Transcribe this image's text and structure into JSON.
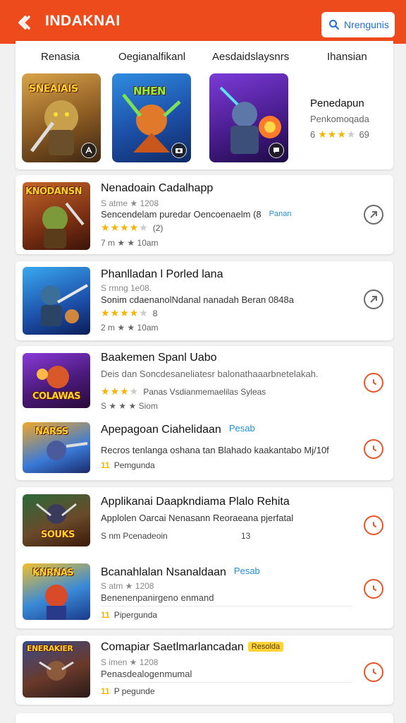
{
  "header": {
    "title": "INDAKNAI",
    "search_label": "Nrengunis",
    "bg_color": "#ee4b1c"
  },
  "featured": {
    "tabs": [
      "Renasia",
      "Oegianalfikanl",
      "Aesdaidslaysnrs",
      "Ihansian"
    ],
    "tiles": [
      {
        "label": "SNEAIAIS",
        "icon": "ninja-icon"
      },
      {
        "label": "NHEN",
        "icon": "camera-icon"
      },
      {
        "label": "",
        "icon": "chat-icon"
      }
    ],
    "info": {
      "title": "Penedapun",
      "subtitle": "Penkomoqada",
      "rating_value": "6",
      "stars": 3,
      "count": "69"
    }
  },
  "list1": {
    "item": {
      "title": "Nenadoain Cadalhapp",
      "line1": "S atme ★ 1208",
      "desc": "Sencendelam puredar Oencoenaelm (8",
      "desc_tag": "Panan",
      "stars": 4,
      "rating_extra": "(2)",
      "line3": "7 m ★ ★ 10am",
      "thumb_text": "KNODANSN"
    }
  },
  "list2": {
    "item": {
      "title": "Phanlladan l Porled lana",
      "line1": "S rmng 1e08.",
      "desc": "Sonim cdaenanolNdanal nanadah Beran 0848a",
      "stars": 4,
      "rating_extra": "8",
      "line3": "2 m ★ ★ 10am"
    }
  },
  "list3": {
    "items": [
      {
        "title": "Baakemen Spanl Uabo",
        "desc": "Deis dan Soncdesaneliatesr balonathaaarbnetelakah.",
        "stars": 3,
        "rating_text": "Panas Vsdianmemaelilas Syleas",
        "line3": "S ★ ★ ★ Siom",
        "thumb_text": "COLAWAS"
      },
      {
        "title": "Apepagoan Ciahelidaan",
        "title_tag": "Pesab",
        "desc": "Recros tenlanga oshana tan Blahado kaakantabo Mj/10f",
        "rank": "11",
        "line3": "Pemgunda",
        "thumb_text": "NARSS"
      }
    ]
  },
  "list4": {
    "items": [
      {
        "title": "Applikanai Daapkndiama Plalo Rehita",
        "desc": "Applolen Oarcai Nenasann Reoraeana pjerfatal",
        "line3": "S nm Pcenadeoin",
        "line3_right": "13",
        "thumb_text": "SOUKS"
      },
      {
        "title": "Bcanahlalan Nsanaldaan",
        "title_tag": "Pesab",
        "line1": "S atm ★ 1208",
        "desc": "Benenenpanirgeno enmand",
        "rank": "11",
        "line3": "Pipergunda",
        "thumb_text": "KNRNAS"
      }
    ]
  },
  "list5": {
    "item": {
      "title": "Comapiar Saetlmarlancadan",
      "title_tag": "Resolda",
      "line1": "S imen ★ 1208",
      "desc": "Penasdealogenmumal",
      "rank": "11",
      "line3": "P pegunde",
      "thumb_text": "ENERAKIER"
    }
  },
  "colors": {
    "accent": "#ee4b1c",
    "star": "#f4b400",
    "link_blue": "#1f6fd6",
    "action_red": "#e8552a"
  }
}
